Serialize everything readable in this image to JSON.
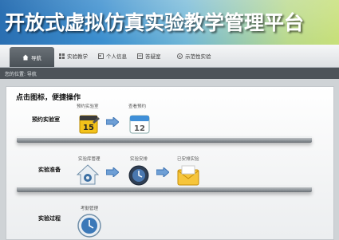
{
  "banner": {
    "title": "开放式虚拟仿真实验教学管理平台"
  },
  "nav": {
    "items": [
      {
        "label": "导航"
      },
      {
        "label": "实验教学"
      },
      {
        "label": "个人信息"
      },
      {
        "label": "答疑室"
      },
      {
        "label": "示范性实验"
      }
    ]
  },
  "breadcrumb": {
    "text": "您的位置: 导航"
  },
  "main": {
    "heading": "点击图标，便捷操作",
    "rows": [
      {
        "label": "预约实验室",
        "items": [
          {
            "caption": "预约实验室"
          },
          {
            "caption": "查看预约"
          }
        ]
      },
      {
        "label": "实验准备",
        "items": [
          {
            "caption": "实验库管理"
          },
          {
            "caption": "实验安排"
          },
          {
            "caption": "已安排实验"
          }
        ]
      },
      {
        "label": "实验过程",
        "items": [
          {
            "caption": "考勤管理"
          }
        ]
      }
    ]
  },
  "colors": {
    "banner_start": "#2a6fb2",
    "banner_end": "#c8e07a",
    "nav_active": "#555b61",
    "breadcrumb_bg": "#4d5359"
  }
}
